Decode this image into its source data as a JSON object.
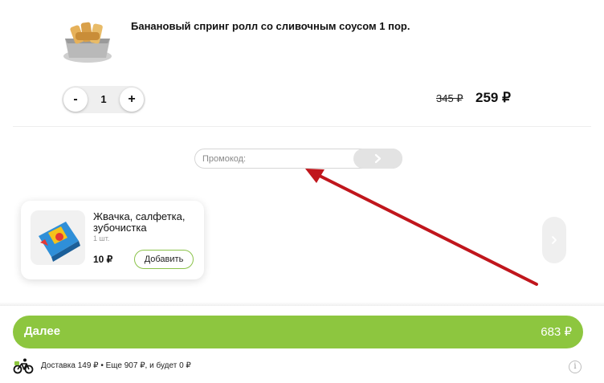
{
  "product": {
    "title": "Банановый спринг ролл со сливочным соусом 1 пор.",
    "image_icon": "banana-spring-roll-dish",
    "quantity": "1",
    "minus_label": "-",
    "plus_label": "+",
    "old_price": "345 ₽",
    "new_price": "259 ₽"
  },
  "promo": {
    "placeholder": "Промокод:",
    "submit_icon": "chevron-right-icon"
  },
  "addon": {
    "title": "Жвачка, салфетка, зубочистка",
    "quantity": "1 шт.",
    "price": "10 ₽",
    "add_label": "Добавить",
    "image_icon": "gum-pack"
  },
  "footer": {
    "next_label": "Далее",
    "total": "683 ₽",
    "delivery_text": "Доставка 149 ₽ • Еще 907 ₽, и будет 0 ₽",
    "delivery_icon": "bicycle-courier-icon",
    "info_label": "i"
  },
  "colors": {
    "accent": "#8dc63f",
    "annotation_arrow": "#c0161c"
  }
}
